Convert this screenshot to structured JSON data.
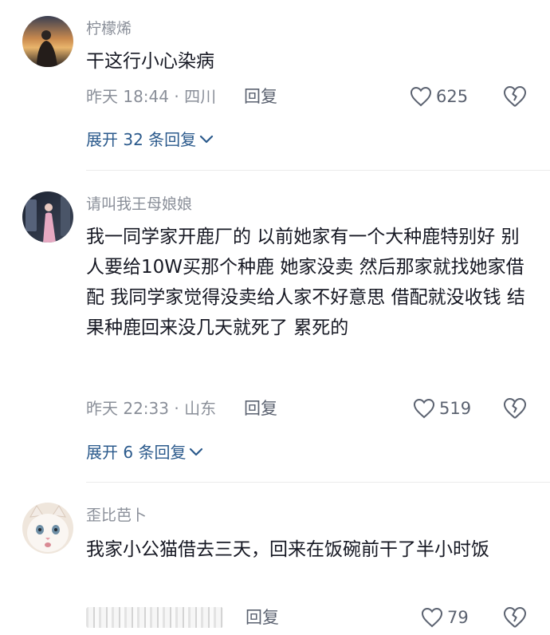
{
  "comments": [
    {
      "username": "柠檬烯",
      "content": "干这行小心染病",
      "meta": "昨天 18:44 · 四川",
      "reply_label": "回复",
      "likes": "625",
      "expand_label": "展开 32 条回复"
    },
    {
      "username": "请叫我王母娘娘",
      "content": "我一同学家开鹿厂的 以前她家有一个大种鹿特别好 别人要给10W买那个种鹿 她家没卖 然后那家就找她家借配 我同学家觉得没卖给人家不好意思 借配就没收钱 结果种鹿回来没几天就死了 累死的",
      "meta": "昨天 22:33 · 山东",
      "reply_label": "回复",
      "likes": "519",
      "expand_label": "展开 6 条回复"
    },
    {
      "username": "歪比芭卜",
      "content": "我家小公猫借去三天，回来在饭碗前干了半小时饭",
      "meta": "",
      "reply_label": "回复",
      "likes": "79"
    }
  ],
  "icons": {
    "like": "heart-outline-icon",
    "dislike": "broken-heart-icon",
    "expand": "chevron-down-icon"
  },
  "colors": {
    "text": "#161823",
    "secondary": "#8a8f99",
    "link": "#2b5a8c"
  }
}
